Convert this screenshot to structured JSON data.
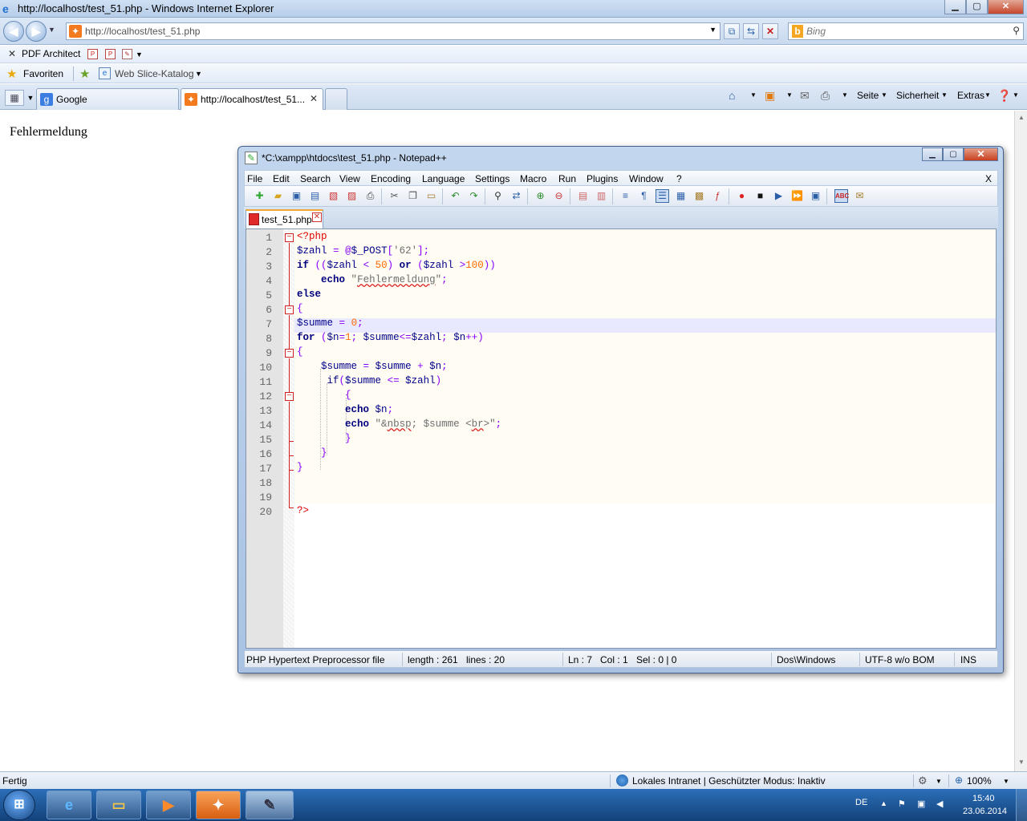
{
  "browser": {
    "title": "http://localhost/test_51.php - Windows Internet Explorer",
    "url": "http://localhost/test_51.php",
    "search_placeholder": "Bing",
    "pdf_toolbar_label": "PDF Architect",
    "favorites_label": "Favoriten",
    "web_slice_label": "Web Slice-Katalog",
    "tabs": [
      {
        "label": "Google"
      },
      {
        "label": "http://localhost/test_51..."
      }
    ],
    "command_bar": {
      "page": "Seite",
      "safety": "Sicherheit",
      "extras": "Extras"
    },
    "page_content": "Fehlermeldung",
    "status": {
      "text": "Fertig",
      "zone": "Lokales Intranet | Geschützter Modus: Inaktiv",
      "zoom": "100%"
    }
  },
  "notepad": {
    "title": "*C:\\xampp\\htdocs\\test_51.php - Notepad++",
    "menu": [
      "File",
      "Edit",
      "Search",
      "View",
      "Encoding",
      "Language",
      "Settings",
      "Macro",
      "Run",
      "Plugins",
      "Window",
      "?"
    ],
    "menu_close": "X",
    "file_tab": "test_51.php",
    "line_numbers": [
      "1",
      "2",
      "3",
      "4",
      "5",
      "6",
      "7",
      "8",
      "9",
      "10",
      "11",
      "12",
      "13",
      "14",
      "15",
      "16",
      "17",
      "18",
      "19",
      "20"
    ],
    "status": {
      "filetype": "PHP Hypertext Preprocessor file",
      "length": "length : 261",
      "lines": "lines : 20",
      "ln": "Ln : 7",
      "col": "Col : 1",
      "sel": "Sel : 0 | 0",
      "eol": "Dos\\Windows",
      "encoding": "UTF-8 w/o BOM",
      "mode": "INS"
    }
  },
  "taskbar": {
    "language": "DE",
    "time": "15:40",
    "date": "23.06.2014"
  }
}
